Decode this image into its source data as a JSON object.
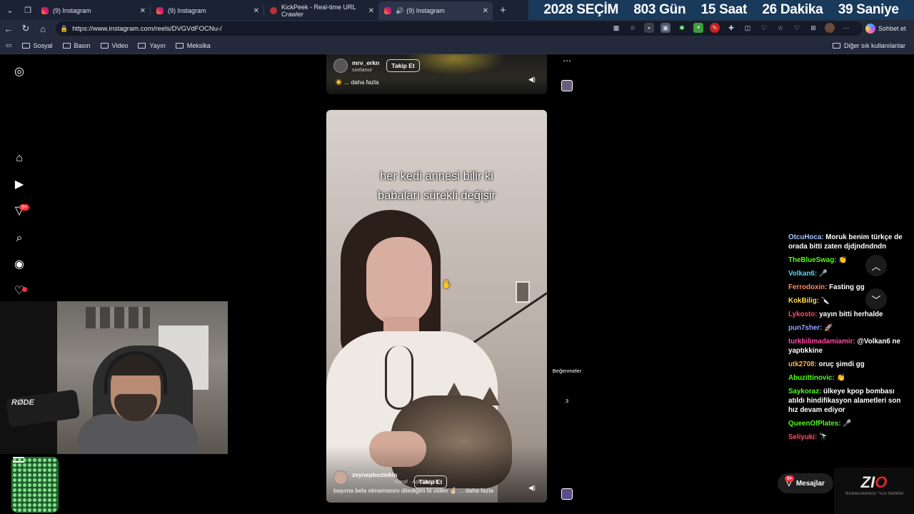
{
  "browser": {
    "tabs": [
      {
        "title": "(9) Instagram",
        "icon": "instagram-icon",
        "active": false
      },
      {
        "title": "(9) Instagram",
        "icon": "instagram-icon",
        "active": false
      },
      {
        "title": "KickPeek - Real-time URL Crawler",
        "icon": "kickpeek-icon",
        "active": false
      },
      {
        "title": "(9) Instagram",
        "icon": "instagram-icon",
        "active": true
      }
    ],
    "url": "https://www.instagram.com/reels/DVGVdFOCNu-/",
    "sohbet": "Sohbet et",
    "bookmarks": [
      "Sosyal",
      "Basın",
      "Video",
      "Yayın",
      "Meksika"
    ],
    "bookmarks_other": "Diğer sık kullanılanlar"
  },
  "election": {
    "title": "2028 SEÇİM",
    "days": "803 Gün",
    "hours": "15 Saat",
    "minutes": "26 Dakika",
    "seconds": "39 Saniye"
  },
  "reels": {
    "previous": {
      "username": "mrv_erkn",
      "sub": "sselanur",
      "follow": "Takip Et",
      "caption": "☀️ ... daha fazla"
    },
    "current": {
      "overlay_line1": "her kedi annesi bilir ki",
      "overlay_line2": "babaları sürekli değişir",
      "username": "zeynepboztekin",
      "sub": "Karaf · Aşk Dardık",
      "follow": "Takip Et",
      "caption": "başıma bela olmamasını dilediğim bi video 🤞🏻 ... daha fazla",
      "likes_label": "Beğenmeler",
      "comments_count": "3"
    }
  },
  "webcam": {
    "mic_brand": "RØDE"
  },
  "chat": {
    "messages": [
      {
        "user": "OtcuHoca:",
        "color": "#a8c4ff",
        "text": "Moruk benim türkçe de orada bitti zaten djdjndndndn"
      },
      {
        "user": "TheBlueSwag:",
        "color": "#53fc18",
        "text": "👏"
      },
      {
        "user": "Volkan6:",
        "color": "#53d4fc",
        "text": "🎤"
      },
      {
        "user": "Ferrodoxin:",
        "color": "#ff8c5a",
        "text": "Fasting gg"
      },
      {
        "user": "KokBilig:",
        "color": "#ffd84a",
        "text": "🔪"
      },
      {
        "user": "Lykosto:",
        "color": "#ff4d6d",
        "text": "yayın bitti herhalde"
      },
      {
        "user": "pun7sher:",
        "color": "#8fa8ff",
        "text": "🚀"
      },
      {
        "user": "turkbilimadamiamir:",
        "color": "#ff4da6",
        "text": "@Volkan6 ne yaptıkkine"
      },
      {
        "user": "utk2708:",
        "color": "#ffb347",
        "text": "oruç şimdi gg"
      },
      {
        "user": "Abuzittinovic:",
        "color": "#53fc18",
        "text": "👏"
      },
      {
        "user": "Saykoraz:",
        "color": "#53fc18",
        "text": "ülkeye kpop bombası atıldı hindifikasyon alametleri son hız devam ediyor"
      },
      {
        "user": "QueenOfPlates:",
        "color": "#53fc18",
        "text": "🎤"
      },
      {
        "user": "Seliyuki:",
        "color": "#ff4d6d",
        "text": "🔭"
      }
    ],
    "messages_button": "Mesajlar",
    "messages_badge": "9+"
  },
  "rail": {
    "notification_badge": "9+"
  },
  "overlay_brand": {
    "logo_text": "ZI",
    "logo_o": "O",
    "promo": "\"BURAKSAKİNOL\" %10 İNDİRİM"
  }
}
